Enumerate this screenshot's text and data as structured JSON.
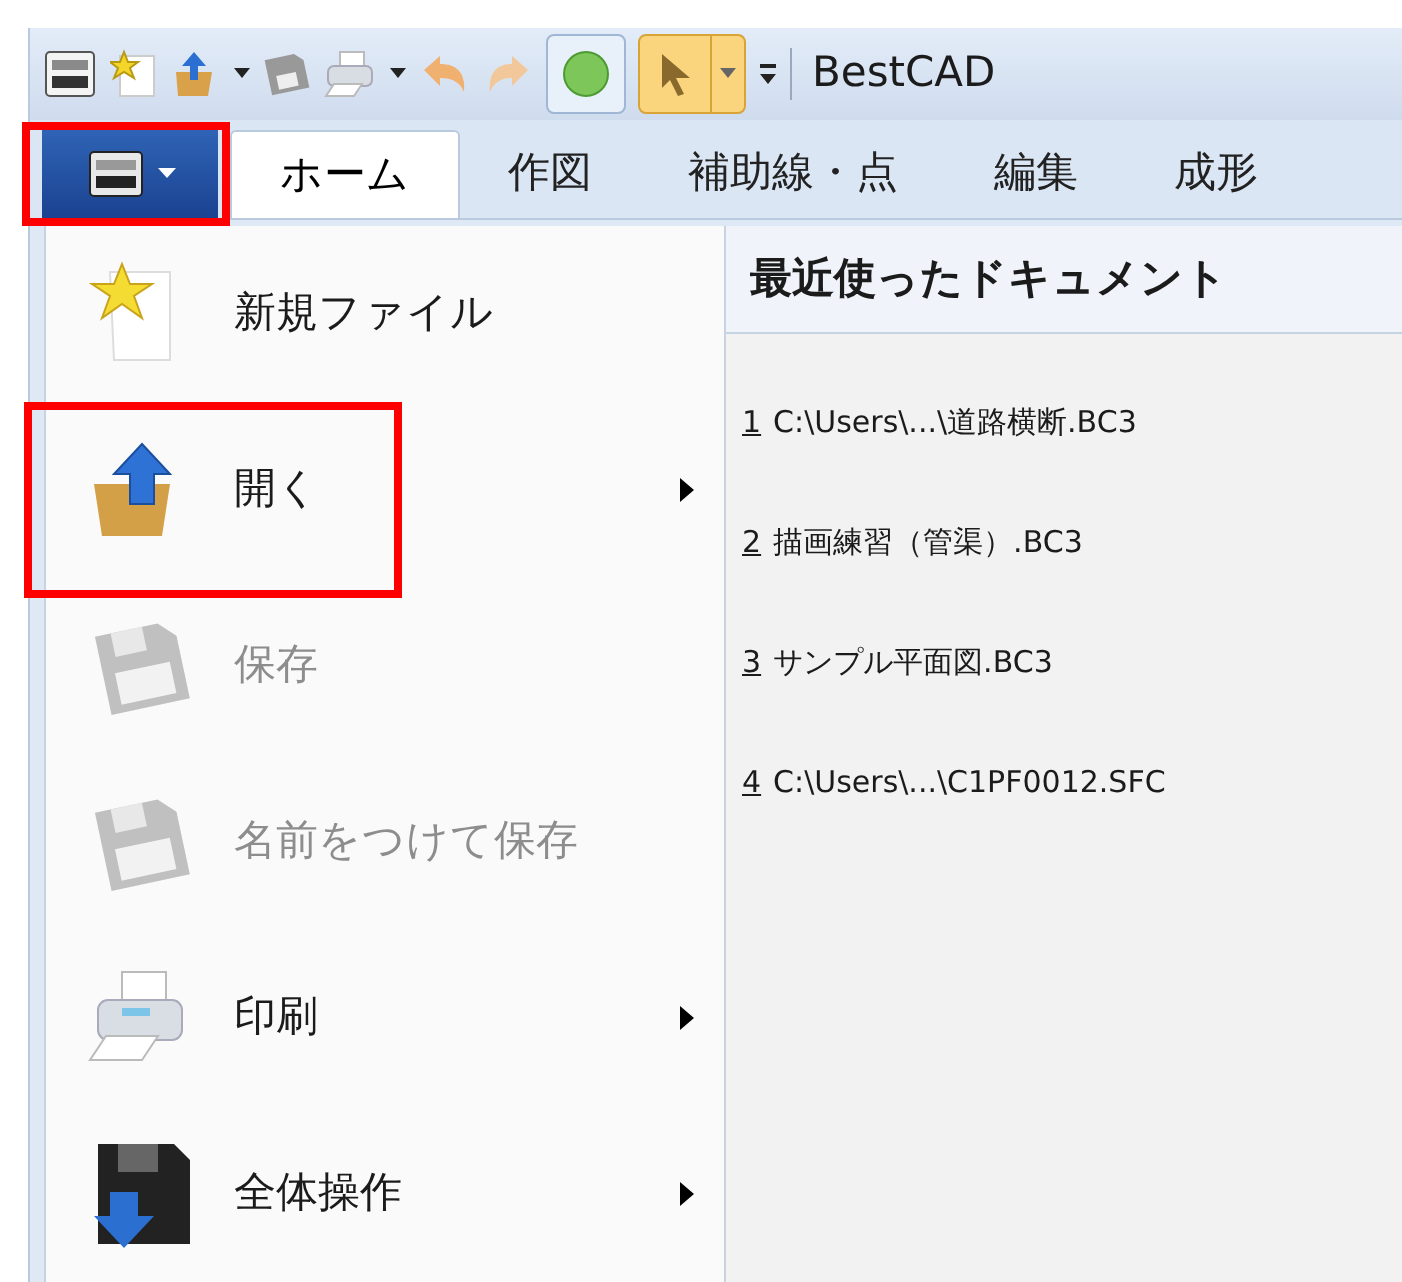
{
  "window": {
    "title": "BestCAD"
  },
  "app_button": {
    "highlighted": true
  },
  "tabs": [
    {
      "label": "ホーム",
      "selected": true
    },
    {
      "label": "作図",
      "selected": false
    },
    {
      "label": "補助線・点",
      "selected": false
    },
    {
      "label": "編集",
      "selected": false
    },
    {
      "label": "成形",
      "selected": false
    }
  ],
  "menu": {
    "items": [
      {
        "label": "新規ファイル",
        "kind": "new",
        "disabled": false,
        "submenu": false,
        "highlighted": false
      },
      {
        "label": "開く",
        "kind": "open",
        "disabled": false,
        "submenu": true,
        "highlighted": true
      },
      {
        "label": "保存",
        "kind": "save",
        "disabled": true,
        "submenu": false,
        "highlighted": false
      },
      {
        "label": "名前をつけて保存",
        "kind": "save",
        "disabled": true,
        "submenu": false,
        "highlighted": false
      },
      {
        "label": "印刷",
        "kind": "print",
        "disabled": false,
        "submenu": true,
        "highlighted": false
      },
      {
        "label": "全体操作",
        "kind": "bulk",
        "disabled": false,
        "submenu": true,
        "highlighted": false
      }
    ]
  },
  "recent": {
    "title": "最近使ったドキュメント",
    "items": [
      {
        "number": "1",
        "name": "C:\\Users\\...\\道路横断.BC3"
      },
      {
        "number": "2",
        "name": "描画練習（管渠）.BC3"
      },
      {
        "number": "3",
        "name": "サンプル平面図.BC3"
      },
      {
        "number": "4",
        "name": "C:\\Users\\...\\C1PF0012.SFC"
      }
    ]
  }
}
